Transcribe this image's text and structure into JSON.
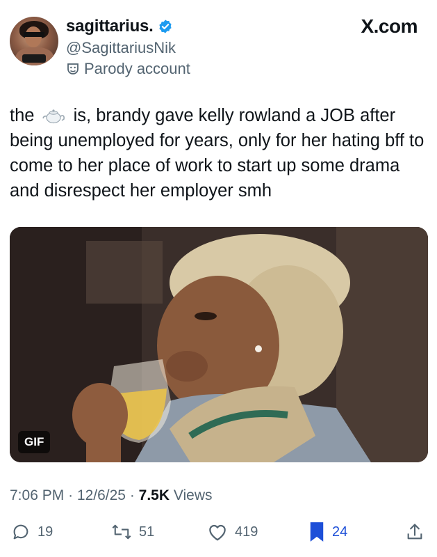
{
  "author": {
    "display_name": "sagittarius.",
    "handle": "@SagittariusNik",
    "label": "Parody account"
  },
  "brand": "X.com",
  "tweet": {
    "text_before": "the",
    "emoji": "teapot-icon",
    "text_after": "is, brandy gave kelly rowland a JOB after being unemployed for years, only for her hating bff to come to her place of work to start up some drama and disrespect her employer smh"
  },
  "media": {
    "type_badge": "GIF"
  },
  "meta": {
    "time": "7:06 PM",
    "date": "12/6/25",
    "views_count": "7.5K",
    "views_label": "Views"
  },
  "actions": {
    "replies": "19",
    "reposts": "51",
    "likes": "419",
    "bookmarks": "24"
  },
  "colors": {
    "verified": "#1d9bf0",
    "bookmark_active": "#1d4fd8",
    "secondary_text": "#536471"
  }
}
